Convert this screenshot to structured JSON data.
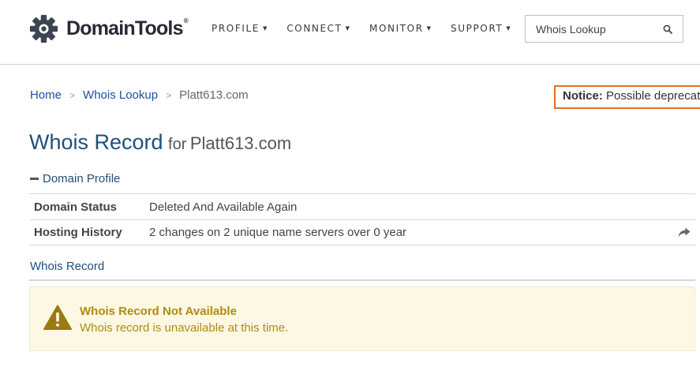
{
  "header": {
    "logo_text": "DomainTools",
    "logo_tm": "®",
    "nav": [
      {
        "label": "PROFILE"
      },
      {
        "label": "CONNECT"
      },
      {
        "label": "MONITOR"
      },
      {
        "label": "SUPPORT"
      }
    ],
    "search": {
      "placeholder": "Whois Lookup",
      "value": ""
    }
  },
  "breadcrumb": {
    "home": "Home",
    "whois_lookup": "Whois Lookup",
    "current": "Platt613.com",
    "separator": ">"
  },
  "notice": {
    "label": "Notice:",
    "text": "Possible deprecation"
  },
  "title": {
    "main": "Whois Record",
    "for": "for",
    "domain": "Platt613.com"
  },
  "domain_profile": {
    "heading": "Domain Profile",
    "rows": [
      {
        "label": "Domain Status",
        "value": "Deleted And Available Again"
      },
      {
        "label": "Hosting History",
        "value": "2 changes on 2 unique name servers over 0 year"
      }
    ]
  },
  "whois_section": {
    "heading": "Whois Record"
  },
  "alert": {
    "title": "Whois Record Not Available",
    "text": "Whois record is unavailable at this time."
  },
  "colors": {
    "brand_blue": "#1f4f7c",
    "link_blue": "#1d50a3",
    "notice_border": "#e46f2a",
    "alert_bg": "#fcf8e3",
    "alert_text": "#b08c12",
    "logo_gear": "#3d4553"
  },
  "icons": {
    "logo": "gear-logo-icon",
    "search": "search-icon",
    "nav_caret": "caret-down-icon",
    "collapse": "minus-icon",
    "share": "share-arrow-icon",
    "warning": "warning-triangle-icon"
  }
}
